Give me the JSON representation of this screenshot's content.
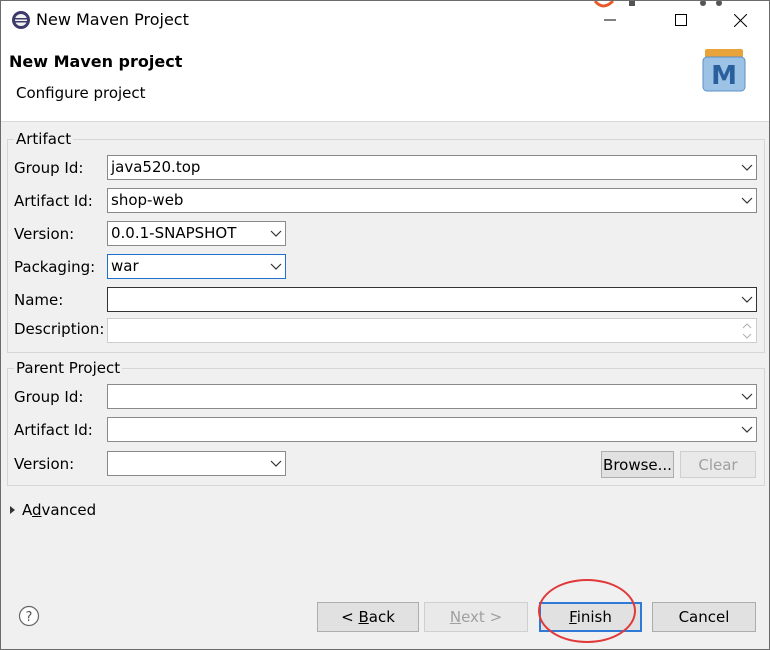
{
  "window": {
    "title": "New Maven Project"
  },
  "header": {
    "title": "New Maven project",
    "subtitle": "Configure project"
  },
  "artifact": {
    "legend": "Artifact",
    "group_id_label": "Group Id:",
    "group_id_value": "java520.top",
    "artifact_id_label": "Artifact Id:",
    "artifact_id_value": "shop-web",
    "version_label": "Version:",
    "version_value": "0.0.1-SNAPSHOT",
    "packaging_label": "Packaging:",
    "packaging_value": "war",
    "name_label": "Name:",
    "name_value": "",
    "description_label": "Description:",
    "description_value": ""
  },
  "parent": {
    "legend": "Parent Project",
    "group_id_label": "Group Id:",
    "artifact_id_label": "Artifact Id:",
    "version_label": "Version:",
    "browse_prefix": "Browse...",
    "clear_label": "Clear"
  },
  "advanced": {
    "label_a": "A",
    "label_d": "d",
    "label_rest": "vanced"
  },
  "footer": {
    "back_prefix": "< ",
    "back_accel": "B",
    "back_rest": "ack",
    "next_accel": "N",
    "next_rest": "ext >",
    "finish_accel": "F",
    "finish_rest": "inish",
    "cancel_label": "Cancel"
  },
  "colors": {
    "annotation": "#e0393a",
    "focus": "#1f6fcc"
  }
}
